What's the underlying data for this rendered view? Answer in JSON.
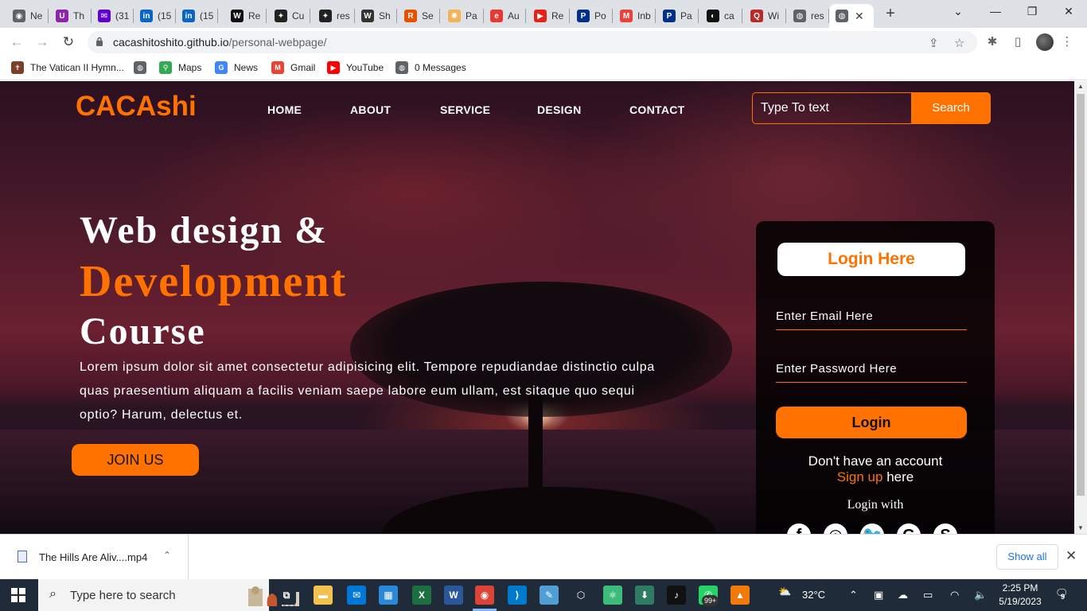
{
  "browser": {
    "tabs": [
      {
        "label": "Ne",
        "icon": "chrome-icon",
        "color": "#5f6368",
        "glyph": "◉"
      },
      {
        "label": "Th",
        "icon": "purple-circle-icon",
        "color": "#8e24aa",
        "glyph": "U"
      },
      {
        "label": "(31",
        "icon": "mail-icon",
        "color": "#6001d2",
        "glyph": "✉"
      },
      {
        "label": "(15",
        "icon": "linkedin-icon",
        "color": "#0a66c2",
        "glyph": "in"
      },
      {
        "label": "(15",
        "icon": "linkedin-icon",
        "color": "#0a66c2",
        "glyph": "in"
      },
      {
        "label": "Re",
        "icon": "wwe-icon",
        "color": "#111111",
        "glyph": "W"
      },
      {
        "label": "Cu",
        "icon": "diamond-icon",
        "color": "#222222",
        "glyph": "✦"
      },
      {
        "label": "res",
        "icon": "diamond-icon",
        "color": "#222222",
        "glyph": "✦"
      },
      {
        "label": "Sh",
        "icon": "wordpress-icon",
        "color": "#333333",
        "glyph": "W"
      },
      {
        "label": "Se",
        "icon": "r-icon",
        "color": "#e65100",
        "glyph": "R"
      },
      {
        "label": "Pa",
        "icon": "sun-icon",
        "color": "#f2b35a",
        "glyph": "✺"
      },
      {
        "label": "Au",
        "icon": "e-icon",
        "color": "#e53935",
        "glyph": "e"
      },
      {
        "label": "Re",
        "icon": "youtube-icon",
        "color": "#e62117",
        "glyph": "▶"
      },
      {
        "label": "Po",
        "icon": "paypal-icon",
        "color": "#003087",
        "glyph": "P"
      },
      {
        "label": "Inb",
        "icon": "gmail-icon",
        "color": "#ea4335",
        "glyph": "M"
      },
      {
        "label": "Pa",
        "icon": "paypal-icon",
        "color": "#003087",
        "glyph": "P"
      },
      {
        "label": "ca",
        "icon": "github-icon",
        "color": "#111111",
        "glyph": "◐"
      },
      {
        "label": "Wi",
        "icon": "quora-icon",
        "color": "#b92b27",
        "glyph": "Q"
      },
      {
        "label": "res",
        "icon": "globe-icon",
        "color": "#5f6368",
        "glyph": "◍"
      }
    ],
    "active_tab_icon": "globe-icon",
    "url_host": "cacashitoshito.github.io",
    "url_path": "/personal-webpage/",
    "bookmarks": [
      {
        "label": "The Vatican II Hymn...",
        "icon": "vatican-icon",
        "color": "#7b3f2a",
        "glyph": "✝"
      },
      {
        "label": "",
        "icon": "globe-icon",
        "color": "#5f6368",
        "glyph": "◍"
      },
      {
        "label": "Maps",
        "icon": "maps-icon",
        "color": "#34a853",
        "glyph": "⚲"
      },
      {
        "label": "News",
        "icon": "news-icon",
        "color": "#4285f4",
        "glyph": "G"
      },
      {
        "label": "Gmail",
        "icon": "gmail-icon",
        "color": "#ea4335",
        "glyph": "M"
      },
      {
        "label": "YouTube",
        "icon": "youtube-icon",
        "color": "#ff0000",
        "glyph": "▶"
      },
      {
        "label": "0 Messages",
        "icon": "globe-icon",
        "color": "#5f6368",
        "glyph": "◍"
      }
    ]
  },
  "site": {
    "logo": "CACAshi",
    "nav": [
      "HOME",
      "ABOUT",
      "SERVICE",
      "DESIGN",
      "CONTACT"
    ],
    "search_placeholder": "Type To text",
    "search_button": "Search",
    "hero": {
      "line1": "Web design &",
      "line2": "Development",
      "line3": "Course",
      "paragraph": "Lorem ipsum dolor sit amet consectetur adipisicing elit. Tempore repudiandae distinctio culpa quas praesentium aliquam a facilis veniam saepe labore eum ullam, est sitaque quo sequi optio? Harum, delectus et.",
      "join_button": "JOIN US"
    },
    "login": {
      "title": "Login Here",
      "email_placeholder": "Enter Email Here",
      "password_placeholder": "Enter Password Here",
      "button": "Login",
      "no_account": "Don't have an account",
      "signup_link": "Sign up",
      "signup_suffix": "here",
      "login_with": "Login with",
      "social_icons": [
        "facebook-icon",
        "instagram-icon",
        "twitter-icon",
        "google-icon",
        "skype-icon"
      ]
    },
    "accent_color": "#ff7200"
  },
  "download_bar": {
    "file_name": "The Hills Are Aliv....mp4",
    "show_all": "Show all"
  },
  "taskbar": {
    "search_text": "Type here to search",
    "apps": [
      {
        "icon": "task-view-icon",
        "color": "#1f2b38",
        "glyph": "⧉"
      },
      {
        "icon": "file-explorer-icon",
        "color": "#f2c14e",
        "glyph": "▬"
      },
      {
        "icon": "mail-icon",
        "color": "#0078d4",
        "glyph": "✉"
      },
      {
        "icon": "store-icon",
        "color": "#2b88d8",
        "glyph": "▦"
      },
      {
        "icon": "excel-icon",
        "color": "#1d6f42",
        "glyph": "X"
      },
      {
        "icon": "word-icon",
        "color": "#2b579a",
        "glyph": "W"
      },
      {
        "icon": "chrome-icon",
        "color": "#db4437",
        "glyph": "◉"
      },
      {
        "icon": "vscode-icon",
        "color": "#007acc",
        "glyph": "⟩"
      },
      {
        "icon": "notepad-icon",
        "color": "#4f9fd6",
        "glyph": "✎"
      },
      {
        "icon": "cube-icon",
        "color": "#1f2b38",
        "glyph": "⬡"
      },
      {
        "icon": "atom-icon",
        "color": "#3dbb7a",
        "glyph": "⚛"
      },
      {
        "icon": "install-icon",
        "color": "#2e7d62",
        "glyph": "⬇"
      },
      {
        "icon": "tiktok-icon",
        "color": "#111111",
        "glyph": "♪"
      },
      {
        "icon": "whatsapp-icon",
        "color": "#25d366",
        "glyph": "✆"
      },
      {
        "icon": "vlc-icon",
        "color": "#f27a0a",
        "glyph": "▲"
      }
    ],
    "whatsapp_badge": "99+",
    "weather": "32°C",
    "time": "2:25 PM",
    "date": "5/19/2023",
    "notification_count": "9"
  }
}
